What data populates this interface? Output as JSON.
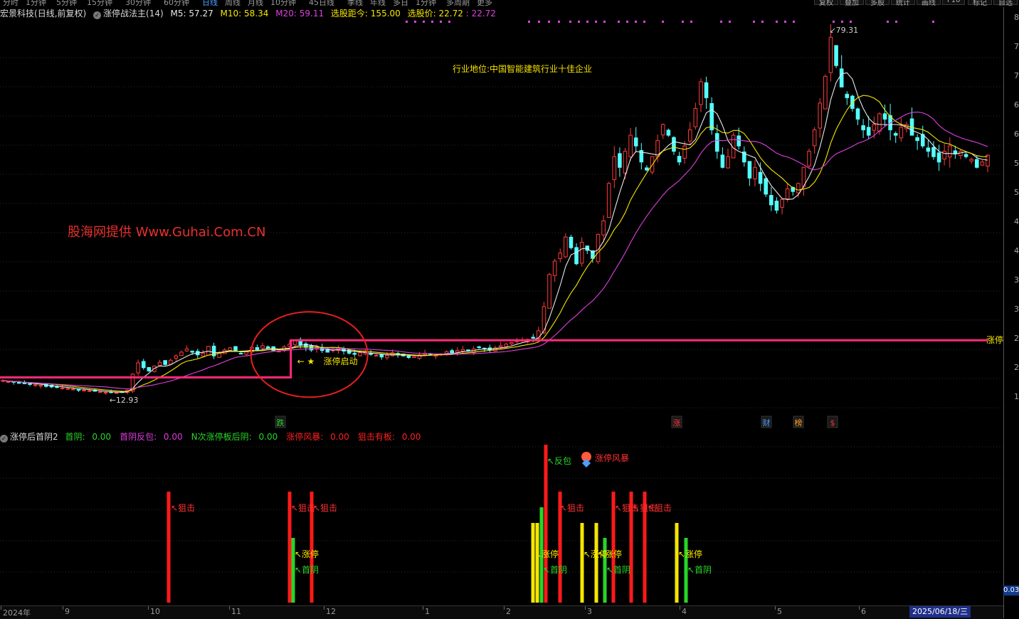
{
  "toolbar": {
    "period_items": [
      "分时",
      "1分钟",
      "5分钟",
      "15分钟",
      "30分钟",
      "60分钟",
      "日线",
      "周线",
      "月线",
      "10分钟",
      "45日线",
      "季线",
      "年线",
      "多日",
      "1分钟",
      "多周期",
      "更多"
    ],
    "right_buttons": [
      "复权",
      "叠加",
      "多股",
      "统计",
      "画线",
      "F10",
      "标记",
      "自选"
    ]
  },
  "main_header": {
    "stock_name": "宏景科技",
    "period": "(日线,前复权)",
    "indicator_name": "涨停战法主(14)",
    "ma5_label": "M5:",
    "ma5_value": "57.27",
    "ma10_label": "M10:",
    "ma10_value": "58.34",
    "ma20_label": "M20:",
    "ma20_value": "59.11",
    "select_dist_label": "选股距今:",
    "select_dist_value": "155.00",
    "select_price_label": "选股价:",
    "select_price_value": "22.72",
    "select_price_value2": "22.72"
  },
  "sub_header": {
    "name": "涨停后首阴2",
    "items": [
      {
        "label": "首阴:",
        "value": "0.00",
        "color": "#28d628"
      },
      {
        "label": "首阴反包:",
        "value": "0.00",
        "color": "#e03ce0"
      },
      {
        "label": "N次涨停板后阴:",
        "value": "0.00",
        "color": "#28d628"
      },
      {
        "label": "涨停风暴:",
        "value": "0.00",
        "color": "#ff2020"
      },
      {
        "label": "狙击有板:",
        "value": "0.00",
        "color": "#ff2020"
      }
    ]
  },
  "annotations": {
    "watermark": "股海网提供 Www.Guhai.Com.CN",
    "industry_note": "行业地位:中国智能建筑行业十佳企业",
    "zhangting_start": "涨停启动",
    "zhangting_line_label": "涨停",
    "low_label": "12.93",
    "high_label": "79.31",
    "event_markers": [
      {
        "text": "跌",
        "color": "#28d628"
      },
      {
        "text": "涨",
        "color": "#ff3030"
      },
      {
        "text": "财",
        "color": "#4aa0ff"
      },
      {
        "text": "榜",
        "color": "#ffa020"
      },
      {
        "text": "$",
        "color": "#ff3030"
      }
    ],
    "sub_labels": {
      "jiji": "狙击",
      "zhangting": "涨停",
      "shouyin": "首阴",
      "fanbao": "反包",
      "fengbao": "涨停风暴"
    }
  },
  "x_axis": {
    "labels": [
      "2024年",
      "9",
      "10",
      "11",
      "12",
      "1",
      "2",
      "3",
      "4",
      "5",
      "6"
    ],
    "current_date": "2025/06/18/三"
  },
  "y_axis": {
    "ticks": [
      "8",
      "7",
      "7",
      "6",
      "6",
      "5",
      "5",
      "4",
      "4",
      "3",
      "3",
      "2",
      "2",
      "1"
    ],
    "sub_value": "0.03"
  },
  "colors": {
    "up": "#ff3b3b",
    "down": "#54ffff",
    "ma5": "#e8e8e8",
    "ma10": "#f5e600",
    "ma20": "#e040e0",
    "zhangting_line": "#ff2a7a",
    "circle": "#e81e1e"
  },
  "chart_data": {
    "type": "candlestick",
    "price_range": [
      10,
      82
    ],
    "period": "daily, 2024-08 to 2025-06",
    "zhangting_price_before": 15.8,
    "zhangting_price_after": 22.72,
    "low_marker": 12.93,
    "high_marker": 79.31,
    "close_series": [
      15.2,
      15.0,
      14.9,
      14.7,
      14.6,
      14.5,
      14.4,
      14.3,
      14.1,
      14.0,
      13.9,
      13.8,
      13.7,
      13.6,
      13.5,
      13.4,
      13.3,
      13.2,
      13.1,
      13.0,
      12.95,
      12.93,
      13.1,
      13.4,
      16.4,
      18.5,
      17.6,
      17.0,
      17.9,
      18.6,
      18.2,
      19.0,
      19.8,
      20.5,
      21.1,
      20.5,
      20.0,
      20.3,
      21.6,
      19.8,
      20.4,
      20.9,
      21.3,
      20.7,
      20.2,
      20.6,
      21.4,
      20.9,
      21.7,
      21.2,
      20.8,
      20.7,
      21.5,
      22.0,
      22.72,
      21.9,
      21.4,
      20.9,
      21.3,
      20.8,
      20.5,
      20.9,
      21.2,
      20.7,
      20.3,
      20.1,
      20.4,
      20.6,
      20.2,
      19.9,
      19.6,
      19.9,
      20.4,
      20.1,
      19.8,
      19.5,
      19.7,
      20.0,
      20.3,
      20.1,
      19.9,
      20.2,
      20.6,
      20.4,
      20.8,
      21.0,
      20.7,
      21.1,
      21.4,
      21.2,
      20.9,
      21.3,
      21.7,
      22.0,
      22.3,
      22.6,
      22.8,
      22.9,
      23.1,
      24.5,
      29.0,
      35.0,
      37.5,
      39.0,
      42.0,
      40.0,
      37.0,
      41.0,
      39.5,
      38.0,
      42.5,
      45.0,
      52.0,
      57.0,
      55.0,
      58.0,
      61.0,
      59.0,
      56.0,
      54.5,
      57.0,
      60.0,
      63.0,
      61.0,
      58.0,
      56.0,
      59.0,
      62.0,
      66.0,
      71.0,
      68.0,
      62.0,
      58.0,
      55.0,
      57.0,
      61.0,
      59.0,
      56.0,
      53.0,
      55.0,
      52.0,
      50.0,
      48.0,
      47.0,
      49.0,
      51.0,
      50.5,
      52.0,
      55.0,
      58.0,
      62.0,
      67.0,
      72.0,
      79.31,
      74.0,
      70.0,
      68.0,
      66.0,
      64.0,
      62.0,
      61.0,
      63.0,
      65.0,
      64.0,
      62.0,
      61.0,
      62.5,
      63.0,
      61.0,
      60.0,
      59.0,
      58.0,
      57.0,
      56.0,
      58.0,
      59.0,
      57.5,
      58.0,
      57.0,
      56.5,
      55.0,
      56.0,
      57.27
    ],
    "sub_signals": [
      {
        "type": "狙击",
        "count": 13
      },
      {
        "type": "涨停",
        "count": 7
      },
      {
        "type": "首阴",
        "count": 6
      },
      {
        "type": "反包",
        "count": 1
      },
      {
        "type": "涨停风暴",
        "count": 1
      }
    ]
  }
}
